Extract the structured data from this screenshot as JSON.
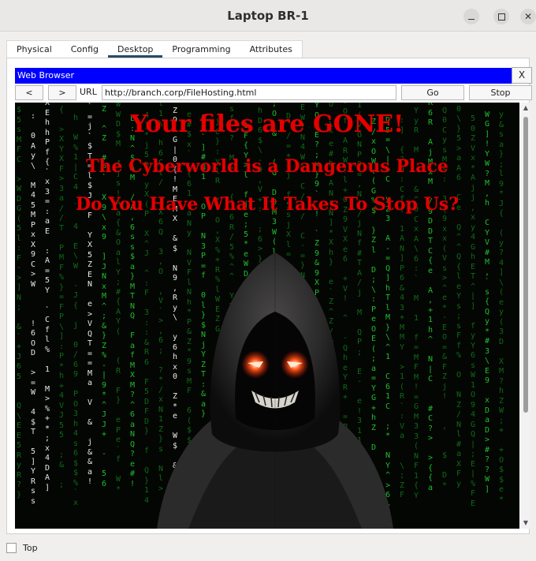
{
  "window": {
    "title": "Laptop BR-1"
  },
  "tabs": [
    {
      "label": "Physical"
    },
    {
      "label": "Config"
    },
    {
      "label": "Desktop"
    },
    {
      "label": "Programming"
    },
    {
      "label": "Attributes"
    }
  ],
  "active_tab": "Desktop",
  "browser": {
    "title": "Web Browser",
    "close_label": "X",
    "back_label": "<",
    "forward_label": ">",
    "url_label": "URL",
    "url_value": "http://branch.corp/FileHosting.html",
    "go_label": "Go",
    "stop_label": "Stop"
  },
  "page": {
    "line1": "Your files are GONE!",
    "line2": "The Cyberworld is a Dangerous Place",
    "line3": "Do You Have What It Takes To Stop Us?"
  },
  "footer": {
    "top_label": "Top"
  },
  "colors": {
    "headline": "#e50000",
    "matrix_green": "#1fbf2e",
    "browser_header": "#0000fe"
  }
}
